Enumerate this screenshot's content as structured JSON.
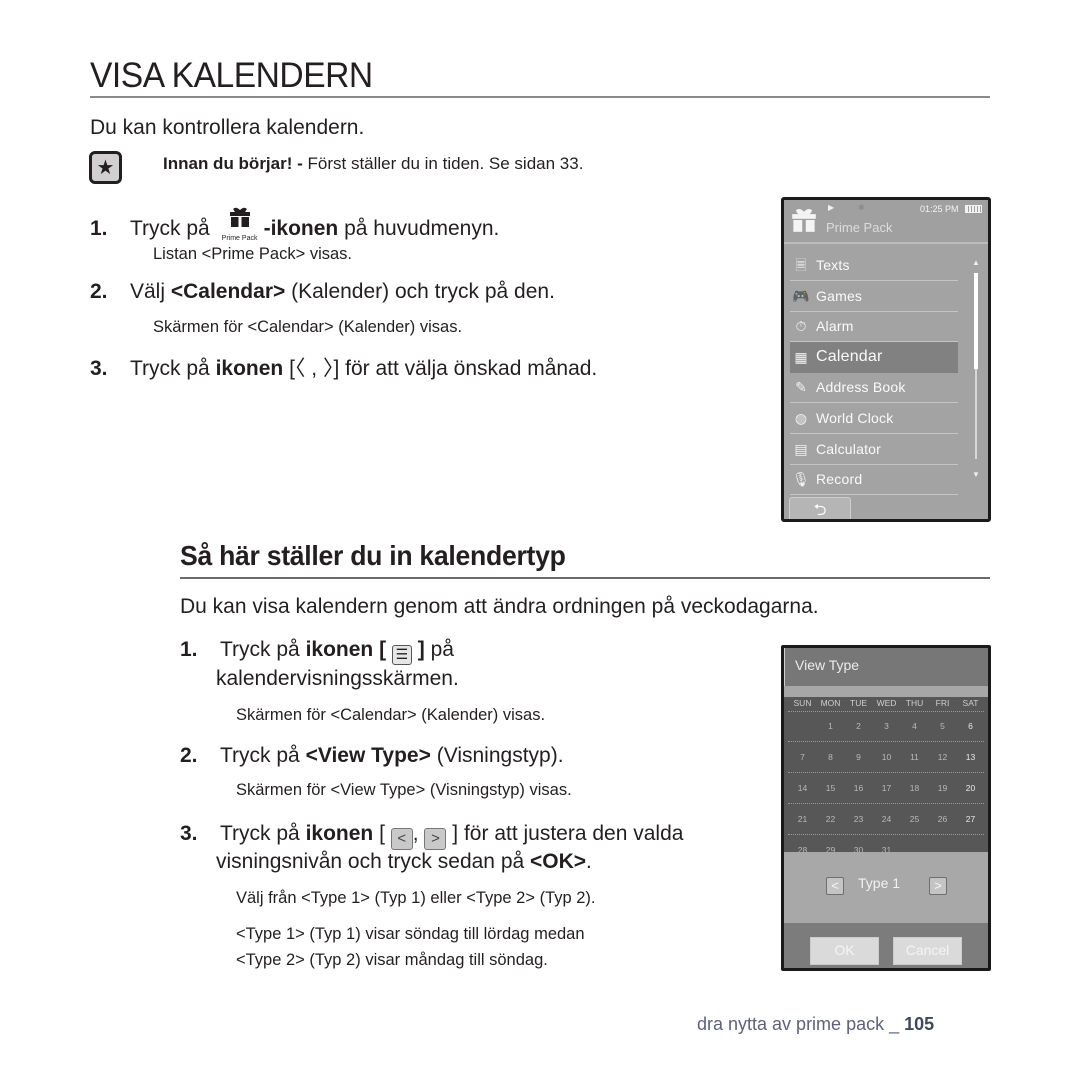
{
  "page": {
    "title": "VISA KALENDERN",
    "intro": "Du kan kontrollera kalendern.",
    "note": {
      "icon": "star-note-icon",
      "bold": "Innan du börjar! -",
      "text": " Först ställer du in tiden. Se sidan 33."
    },
    "steps": [
      {
        "num": "1.",
        "pre": "Tryck på",
        "icon_caption": "Prime Pack",
        "bold": "-ikonen",
        "post": " på huvudmenyn.",
        "sub": "Listan <Prime Pack> visas."
      },
      {
        "num": "2.",
        "pre": "Välj ",
        "bold": "<Calendar>",
        "post": " (Kalender) och tryck på den.",
        "sub": "Skärmen för <Calendar> (Kalender) visas."
      },
      {
        "num": "3.",
        "pre": "Tryck på ",
        "bold": "ikonen",
        "bracket": " [〈 , 〉]",
        "post": " för att välja önskad månad."
      }
    ],
    "section2": {
      "title": "Så här ställer du in kalendertyp",
      "intro": "Du kan visa kalendern genom att ändra ordningen på veckodagarna.",
      "steps": [
        {
          "num": "1.",
          "pre": "Tryck på ",
          "bold": "ikonen [",
          "bold_end": "]",
          "post": " på",
          "line2": "kalendervisningsskärmen.",
          "sub": "Skärmen för <Calendar> (Kalender) visas."
        },
        {
          "num": "2.",
          "pre": "Tryck på ",
          "bold": "<View Type>",
          "post": " (Visningstyp).",
          "sub": "Skärmen för <View Type> (Visningstyp) visas."
        },
        {
          "num": "3.",
          "pre": "Tryck på ",
          "bold": "ikonen",
          "open": " [ ",
          "comma": ",",
          "close": " ]",
          "post": " för att justera den valda",
          "line2_pre": "visningsnivån och tryck sedan på ",
          "line2_bold": "<OK>",
          "line2_post": ".",
          "sub1": "Välj från <Type 1> (Typ 1) eller <Type 2> (Typ 2).",
          "sub2a": "<Type 1> (Typ 1) visar söndag till lördag medan",
          "sub2b": "<Type 2> (Typ 2) visar måndag till söndag."
        }
      ]
    },
    "footer": {
      "text": "dra nytta av prime pack _ ",
      "page_number": "105"
    }
  },
  "device1": {
    "time": "01:25 PM",
    "title": "Prime Pack",
    "menu": [
      {
        "label": "Texts",
        "icon": "texts-icon",
        "glyph": "🗏"
      },
      {
        "label": "Games",
        "icon": "gamepad-icon",
        "glyph": "🎮"
      },
      {
        "label": "Alarm",
        "icon": "alarm-icon",
        "glyph": "⏱"
      },
      {
        "label": "Calendar",
        "icon": "calendar-icon",
        "glyph": "▦",
        "selected": true
      },
      {
        "label": "Address Book",
        "icon": "address-book-icon",
        "glyph": "✎"
      },
      {
        "label": "World Clock",
        "icon": "globe-icon",
        "glyph": "◍"
      },
      {
        "label": "Calculator",
        "icon": "calculator-icon",
        "glyph": "▤"
      },
      {
        "label": "Record",
        "icon": "microphone-icon",
        "glyph": "🎙"
      }
    ],
    "back_glyph": "⮌"
  },
  "device2": {
    "title": "View Type",
    "weekdays": [
      "SUN",
      "MON",
      "TUE",
      "WED",
      "THU",
      "FRI",
      "SAT"
    ],
    "weeks": [
      [
        "",
        "1",
        "2",
        "3",
        "4",
        "5",
        "6"
      ],
      [
        "7",
        "8",
        "9",
        "10",
        "11",
        "12",
        "13"
      ],
      [
        "14",
        "15",
        "16",
        "17",
        "18",
        "19",
        "20"
      ],
      [
        "21",
        "22",
        "23",
        "24",
        "25",
        "26",
        "27"
      ],
      [
        "28",
        "29",
        "30",
        "31",
        "",
        "",
        ""
      ]
    ],
    "type_value": "Type 1",
    "prev_glyph": "<",
    "next_glyph": ">",
    "ok_label": "OK",
    "cancel_label": "Cancel"
  }
}
